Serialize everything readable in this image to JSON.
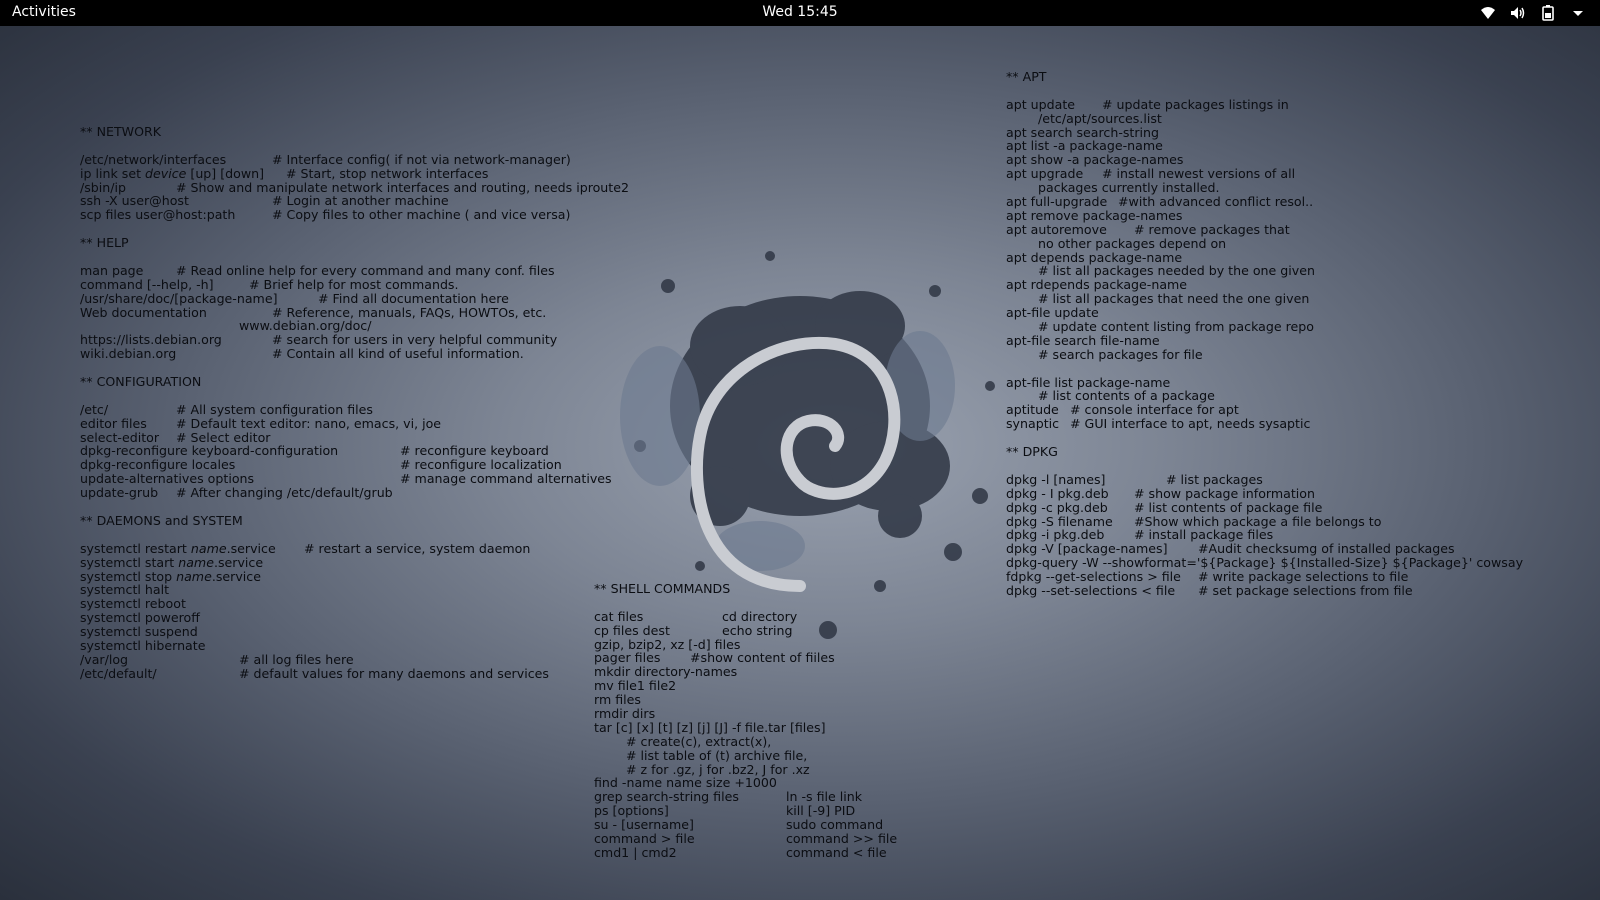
{
  "topbar": {
    "activities": "Activities",
    "clock": "Wed 15:45",
    "icons": [
      "wifi-icon",
      "volume-icon",
      "battery-icon",
      "menu-arrow-icon"
    ]
  },
  "desktop": {
    "background_accent": "#7d8594",
    "text_color": "#0b0d12",
    "network": {
      "heading": "** NETWORK",
      "rows": [
        {
          "cmd": "/etc/network/interfaces",
          "desc": "# Interface config( if not via network-manager)"
        },
        {
          "cmd_prefix": "ip link set ",
          "cmd_italic": "device",
          "cmd_suffix": " [up] [down]",
          "desc": "# Start, stop network interfaces"
        },
        {
          "cmd": "/sbin/ip",
          "desc": "# Show and manipulate network interfaces and routing, needs iproute2"
        },
        {
          "cmd": "ssh -X user@host",
          "desc": "# Login at another machine"
        },
        {
          "cmd": "scp files user@host:path",
          "desc": "# Copy files to other machine ( and vice versa)"
        }
      ]
    },
    "help": {
      "heading": "** HELP",
      "rows": [
        {
          "cmd": "man page",
          "desc": "# Read online help for every command and many conf. files"
        },
        {
          "cmd": "command [--help, -h]",
          "desc": "# Brief help for most commands."
        },
        {
          "cmd": "/usr/share/doc/[package-name]",
          "desc": "# Find all documentation here"
        },
        {
          "cmd": "Web documentation",
          "desc": "# Reference, manuals, FAQs, HOWTOs, etc."
        },
        {
          "cmd": "",
          "desc": "www.debian.org/doc/"
        },
        {
          "cmd": "https://lists.debian.org",
          "desc": "# search for users in very helpful community"
        },
        {
          "cmd": "wiki.debian.org",
          "desc": "# Contain all kind of useful information."
        }
      ]
    },
    "configuration": {
      "heading": "** CONFIGURATION",
      "rows": [
        {
          "cmd": "/etc/",
          "desc": "# All system configuration files"
        },
        {
          "cmd": "editor files",
          "desc": "# Default text editor: nano, emacs, vi, joe"
        },
        {
          "cmd": "select-editor",
          "desc": "# Select editor"
        },
        {
          "cmd": "dpkg-reconfigure keyboard-configuration",
          "desc": "# reconfigure keyboard"
        },
        {
          "cmd": "dpkg-reconfigure locales",
          "desc": "# reconfigure localization"
        },
        {
          "cmd": "update-alternatives options",
          "desc": "# manage command alternatives"
        },
        {
          "cmd": "update-grub",
          "desc": "# After changing /etc/default/grub"
        }
      ]
    },
    "daemons": {
      "heading": "** DAEMONS and SYSTEM",
      "rows": [
        {
          "pre": "systemctl restart ",
          "it": "name",
          "post": ".service",
          "desc": "# restart a service, system daemon"
        },
        {
          "pre": "systemctl start ",
          "it": "name",
          "post": ".service",
          "desc": ""
        },
        {
          "pre": "systemctl stop ",
          "it": "name",
          "post": ".service",
          "desc": ""
        },
        {
          "pre": "systemctl halt",
          "it": "",
          "post": "",
          "desc": ""
        },
        {
          "pre": "systemctl reboot",
          "it": "",
          "post": "",
          "desc": ""
        },
        {
          "pre": "systemctl poweroff",
          "it": "",
          "post": "",
          "desc": ""
        },
        {
          "pre": "systemctl suspend",
          "it": "",
          "post": "",
          "desc": ""
        },
        {
          "pre": "systemctl hibernate",
          "it": "",
          "post": "",
          "desc": ""
        },
        {
          "pre": "/var/log",
          "it": "",
          "post": "",
          "desc": "# all log files here"
        },
        {
          "pre": "/etc/default/",
          "it": "",
          "post": "",
          "desc": "# default values for many daemons and services"
        }
      ]
    },
    "shell": {
      "heading": "** SHELL COMMANDS",
      "rows": [
        {
          "a": "cat files",
          "b": "cd directory"
        },
        {
          "a": "cp files dest",
          "b": "echo string"
        },
        {
          "a": "gzip, bzip2, xz [-d] files",
          "b": ""
        },
        {
          "a": "pager files",
          "b": "#show content of fiiles"
        },
        {
          "a": "mkdir directory-names",
          "b": ""
        },
        {
          "a": "mv file1 file2",
          "b": ""
        },
        {
          "a": "rm files",
          "b": ""
        },
        {
          "a": "rmdir dirs",
          "b": ""
        },
        {
          "a": "tar [c] [x] [t] [z] [j] [J] -f file.tar [files]",
          "b": ""
        },
        {
          "a": "# create(c), extract(x),",
          "b": "",
          "indent": true
        },
        {
          "a": "# list table of (t) archive file,",
          "b": "",
          "indent": true
        },
        {
          "a": "# z for .gz, j for .bz2, J for .xz",
          "b": "",
          "indent": true
        },
        {
          "a": "find -name name size +1000",
          "b": ""
        },
        {
          "a": "grep search-string files",
          "b": "ln -s file link"
        },
        {
          "a": "ps [options]",
          "b": "kill [-9] PID"
        },
        {
          "a": "su - [username]",
          "b": "sudo command"
        },
        {
          "a": "command > file",
          "b": "command >> file"
        },
        {
          "a": "cmd1 | cmd2",
          "b": "command < file"
        }
      ]
    },
    "apt": {
      "heading": "** APT",
      "rows": [
        {
          "cmd": "apt update",
          "desc": "# update packages listings in"
        },
        {
          "cont": "/etc/apt/sources.list"
        },
        {
          "cmd": "apt search search-string",
          "desc": ""
        },
        {
          "cmd": "apt list -a package-name",
          "desc": ""
        },
        {
          "cmd": "apt show -a package-names",
          "desc": ""
        },
        {
          "cmd": "apt upgrade",
          "desc": "# install newest versions of all"
        },
        {
          "cont": "packages currently installed."
        },
        {
          "cmd": "apt full-upgrade",
          "desc": "#with advanced conflict resol.."
        },
        {
          "cmd": "apt remove package-names",
          "desc": ""
        },
        {
          "cmd": "apt autoremove",
          "desc": "# remove packages that"
        },
        {
          "cont": "no other packages depend on"
        },
        {
          "cmd": "apt depends package-name",
          "desc": ""
        },
        {
          "cont": "# list all packages needed by the one given"
        },
        {
          "cmd": "apt rdepends package-name",
          "desc": ""
        },
        {
          "cont": "# list all packages that need the one given"
        },
        {
          "cmd": "apt-file update",
          "desc": ""
        },
        {
          "cont": "# update content listing from package repo"
        },
        {
          "cmd": "apt-file search file-name",
          "desc": ""
        },
        {
          "cont": "# search packages for file"
        },
        {
          "blank": true
        },
        {
          "cmd": "apt-file list package-name",
          "desc": ""
        },
        {
          "cont": "# list contents of a package"
        },
        {
          "cmd": "aptitude",
          "desc": "# console interface for apt"
        },
        {
          "cmd": "synaptic",
          "desc": "# GUI interface to apt, needs sysaptic"
        }
      ]
    },
    "dpkg": {
      "heading": "** DPKG",
      "rows": [
        {
          "cmd": "dpkg -l [names]",
          "desc": "# list packages"
        },
        {
          "cmd": "dpkg - I pkg.deb",
          "desc": "# show package information"
        },
        {
          "cmd": "dpkg -c pkg.deb",
          "desc": "# list contents of package file"
        },
        {
          "cmd": "dpkg -S filename",
          "desc": "#Show which package a file belongs to"
        },
        {
          "cmd": "dpkg -i pkg.deb",
          "desc": "# install package files"
        },
        {
          "cmd": "dpkg -V [package-names]",
          "desc": "#Audit checksumg of installed packages"
        },
        {
          "cmd": "dpkg-query -W --showformat='${Package} ${Installed-Size} ${Package}' cowsay",
          "desc": ""
        },
        {
          "cmd": "fdpkg --get-selections > file",
          "desc": "# write package selections to file"
        },
        {
          "cmd": "dpkg --set-selections < file",
          "desc": "# set package selections from file"
        }
      ]
    }
  }
}
